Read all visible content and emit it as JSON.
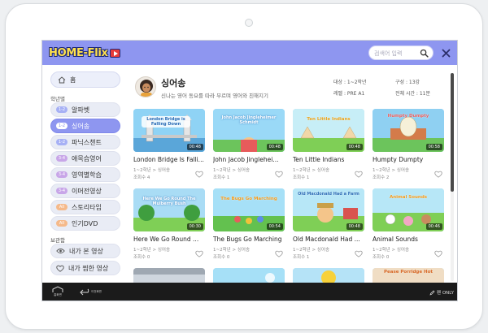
{
  "app": {
    "logo_text": "HOME-Flix"
  },
  "search": {
    "placeholder": "검색어 입력"
  },
  "sidebar": {
    "home_label": "홈",
    "grade_section": "학년별",
    "items": [
      {
        "badge": "1-2",
        "label": "알파벳",
        "badge_color": "#a6b0f5",
        "active": false
      },
      {
        "badge": "1-2",
        "label": "싱어송",
        "badge_color": "#a6b0f5",
        "active": true
      },
      {
        "badge": "1-2",
        "label": "파닉스챈트",
        "badge_color": "#a6b0f5",
        "active": false
      },
      {
        "badge": "3-4",
        "label": "애목습영어",
        "badge_color": "#c8a6e8",
        "active": false
      },
      {
        "badge": "3-4",
        "label": "영역별학습",
        "badge_color": "#c8a6e8",
        "active": false
      },
      {
        "badge": "3-4",
        "label": "이머전영상",
        "badge_color": "#c8a6e8",
        "active": false
      },
      {
        "badge": "All",
        "label": "스토리타임",
        "badge_color": "#f5b98a",
        "active": false
      },
      {
        "badge": "All",
        "label": "인기DVD",
        "badge_color": "#f5b98a",
        "active": false
      }
    ],
    "saved_section": "보관함",
    "saved": [
      {
        "label": "내가 본 영상",
        "icon": "eye-icon"
      },
      {
        "label": "내가 찜한 영상",
        "icon": "heart-icon"
      }
    ]
  },
  "main": {
    "title": "싱어송",
    "description": "신나는 영어 동요를 따라 부르며 영어와 친해지기",
    "meta": {
      "target": "대상 : 1~2학년",
      "composition": "구성 : 13강",
      "level": "레벨 : PRE A1",
      "total_time": "전체 시간 : 11분"
    },
    "videos": [
      {
        "title": "London Bridge Is Falli...",
        "thumb_text": "London Bridge is Falling Down",
        "duration": "00:48",
        "grade": "1~2학년 > 싱어송",
        "views": "조회수 4"
      },
      {
        "title": "John Jacob Jinglehei...",
        "thumb_text": "John Jacob Jingleheimer Schmidt",
        "duration": "00:48",
        "grade": "1~2학년 > 싱어송",
        "views": "조회수 1"
      },
      {
        "title": "Ten Little Indians",
        "thumb_text": "Ten Little Indians",
        "duration": "00:48",
        "grade": "1~2학년 > 싱어송",
        "views": "조회수 1"
      },
      {
        "title": "Humpty Dumpty",
        "thumb_text": "Humpty Dumpty",
        "duration": "00:58",
        "grade": "1~2학년 > 싱어송",
        "views": "조회수 2"
      },
      {
        "title": "Here We Go Round ...",
        "thumb_text": "Here We Go Round The Mulberry Bush",
        "duration": "00:30",
        "grade": "1~2학년 > 싱어송",
        "views": "조회수 0"
      },
      {
        "title": "The Bugs Go Marching",
        "thumb_text": "The Bugs Go Marching",
        "duration": "00:54",
        "grade": "1~2학년 > 싱어송",
        "views": "조회수 0"
      },
      {
        "title": "Old Macdonald Had ...",
        "thumb_text": "Old Macdonald Had a Farm",
        "duration": "00:48",
        "grade": "1~2학년 > 싱어송",
        "views": "조회수 1"
      },
      {
        "title": "Animal Sounds",
        "thumb_text": "Animal Sounds",
        "duration": "00:46",
        "grade": "1~2학년 > 싱어송",
        "views": "조회수 0"
      },
      {
        "title": "",
        "thumb_text": "",
        "duration": "",
        "grade": "",
        "views": ""
      },
      {
        "title": "",
        "thumb_text": "",
        "duration": "",
        "grade": "",
        "views": ""
      },
      {
        "title": "",
        "thumb_text": "",
        "duration": "",
        "grade": "",
        "views": ""
      },
      {
        "title": "",
        "thumb_text": "Pease Porridge Hot",
        "duration": "",
        "grade": "",
        "views": ""
      }
    ]
  },
  "bottombar": {
    "home_label": "홈화면",
    "back_label": "이전화면",
    "pen_label": "펜 ONLY"
  },
  "colors": {
    "header": "#8e96f0",
    "active_nav": "#8e96f0",
    "logo_yellow": "#ffe14d",
    "bottom_bar": "#1b1b1b"
  }
}
